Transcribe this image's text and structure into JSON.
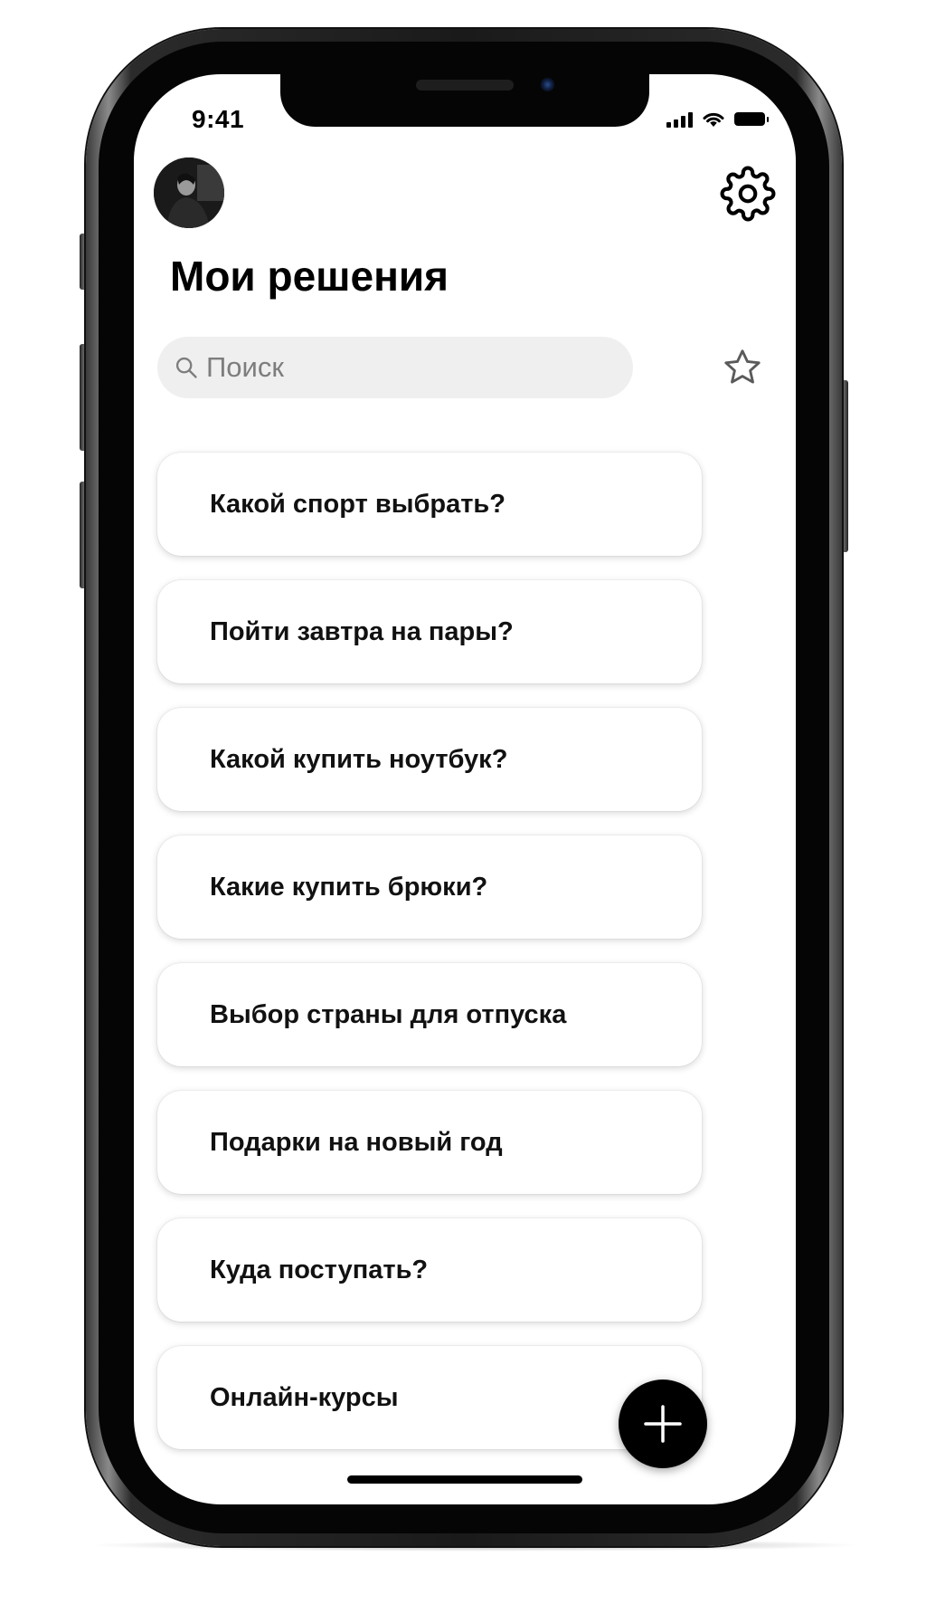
{
  "status_bar": {
    "time": "9:41",
    "icons": [
      "signal-icon",
      "wifi-icon",
      "battery-icon"
    ]
  },
  "header": {
    "avatar": "avatar",
    "settings_icon": "gear-icon"
  },
  "page": {
    "title": "Мои решения"
  },
  "search": {
    "placeholder": "Поиск",
    "value": "",
    "icon": "search-icon",
    "favorites_icon": "star-icon"
  },
  "decisions": [
    {
      "label": "Какой спорт выбрать?"
    },
    {
      "label": "Пойти завтра на пары?"
    },
    {
      "label": "Какой купить ноутбук?"
    },
    {
      "label": "Какие купить брюки?"
    },
    {
      "label": "Выбор страны для отпуска"
    },
    {
      "label": "Подарки на новый год"
    },
    {
      "label": "Куда поступать?"
    },
    {
      "label": "Онлайн-курсы"
    }
  ],
  "fab": {
    "icon": "plus-icon"
  },
  "colors": {
    "background": "#ffffff",
    "text": "#000000",
    "search_bg": "#efefef",
    "placeholder": "#7d7d7d",
    "fab": "#000000"
  }
}
